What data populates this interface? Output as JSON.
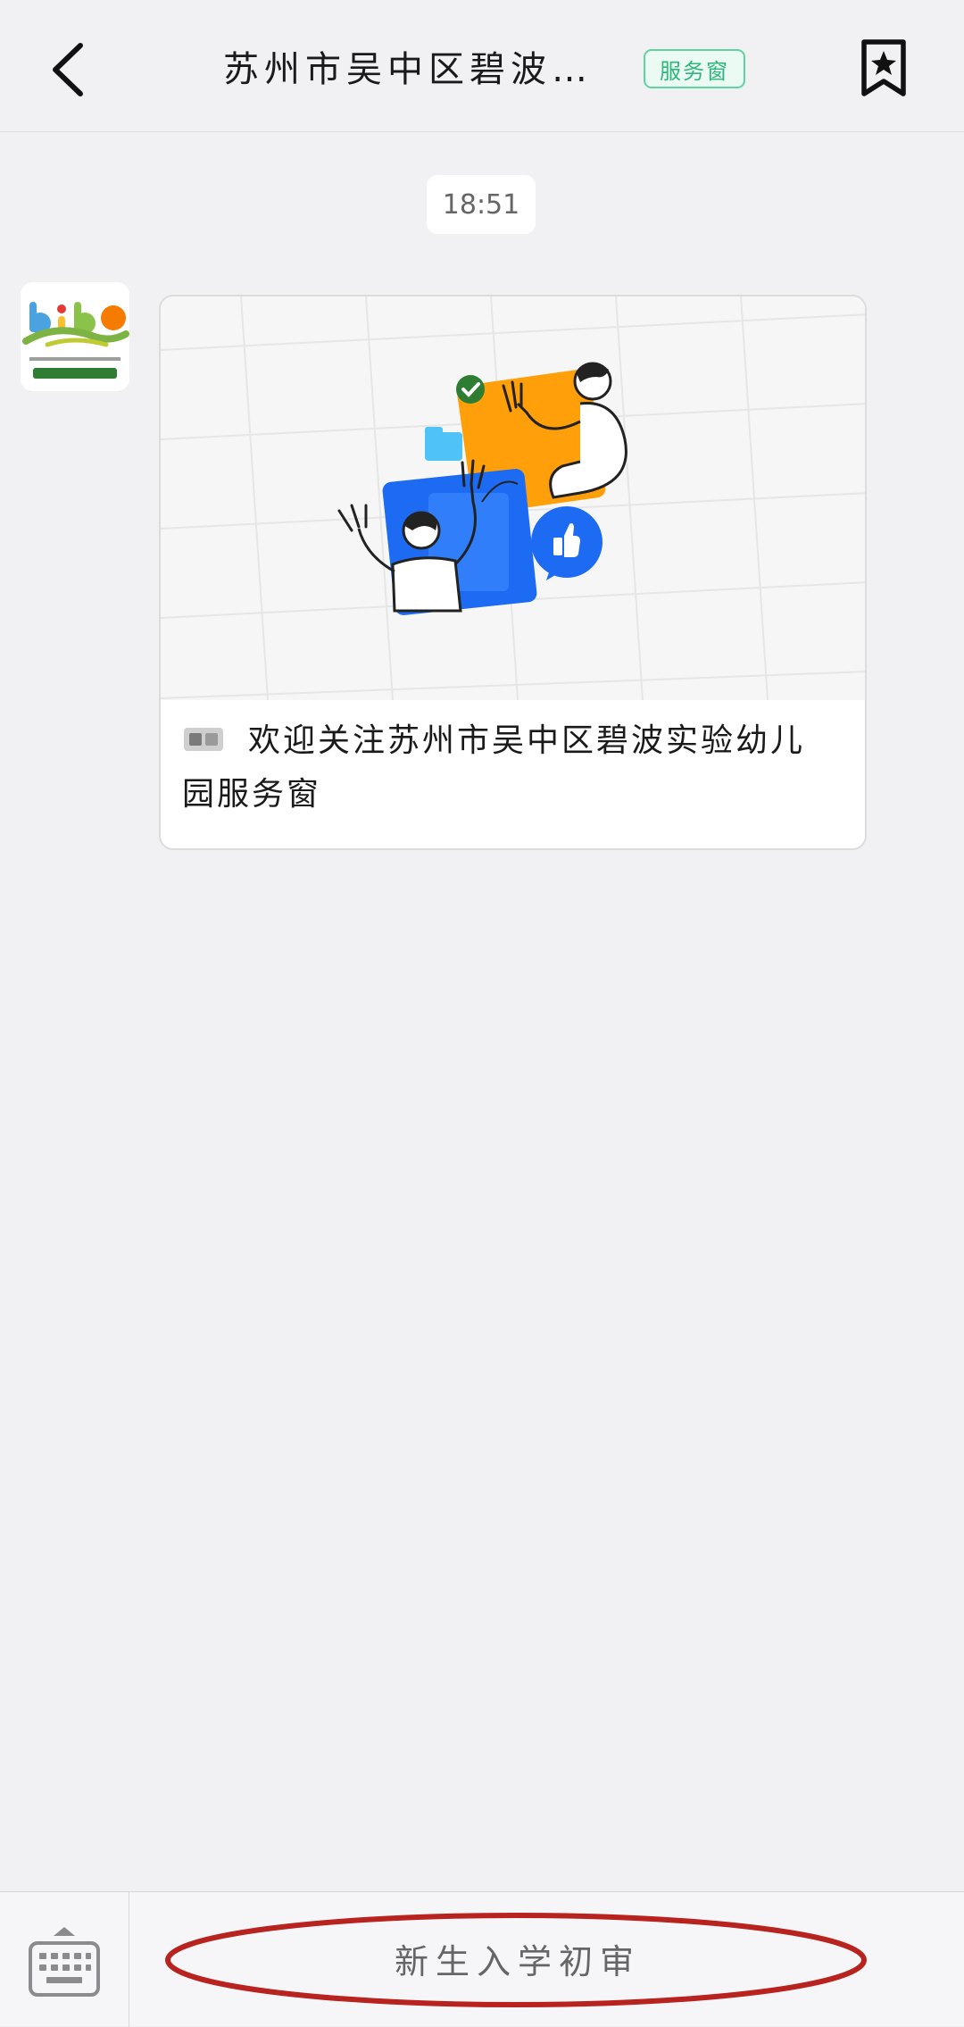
{
  "header": {
    "back_icon": "chevron-left-icon",
    "title": "苏州市吴中区碧波…",
    "badge": "服务窗",
    "bookmark_icon": "bookmark-star-icon"
  },
  "chat": {
    "timestamp": "18:51",
    "avatar_icon": "kindergarten-logo-icon",
    "card": {
      "caption": "欢迎关注苏州市吴中区碧波实验幼儿园服务窗"
    }
  },
  "footer": {
    "keyboard_icon": "keyboard-icon",
    "menu_label": "新生入学初审"
  },
  "colors": {
    "background": "#f1f1f4",
    "badge_green": "#2fb67c",
    "annotation_red": "#b8231f",
    "illustration_orange": "#ff9f0a",
    "illustration_blue": "#1d6bf3"
  }
}
